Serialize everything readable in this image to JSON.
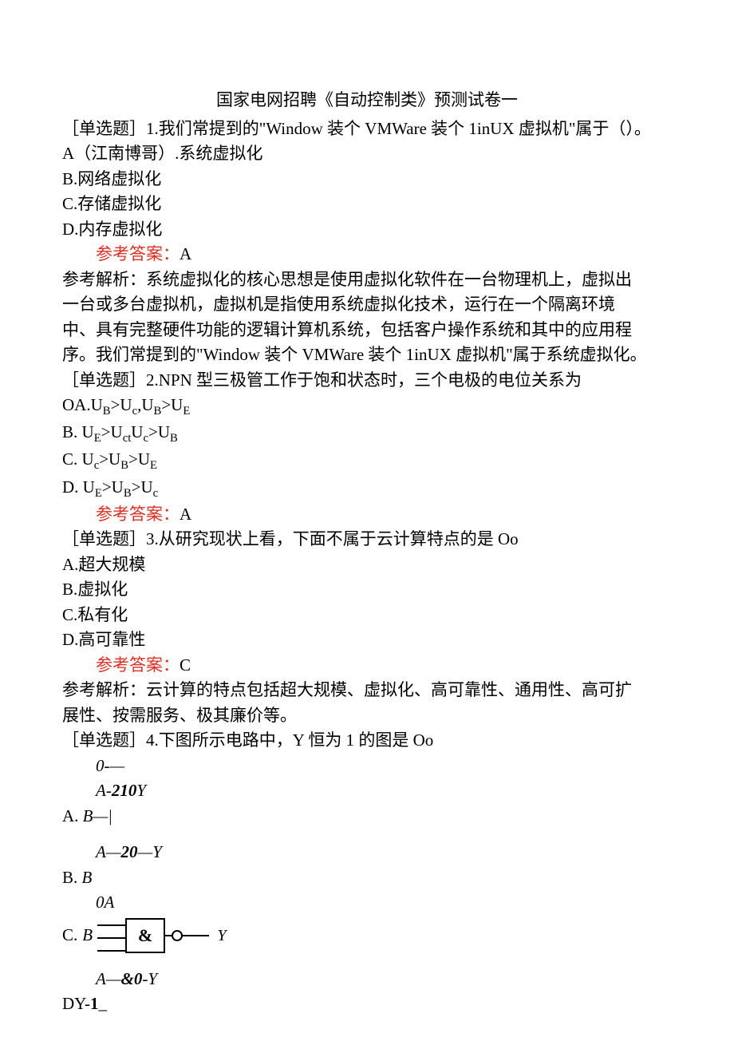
{
  "title": "国家电网招聘《自动控制类》预测试卷一",
  "q1": {
    "stem": "［单选题］1.我们常提到的\"Window 装个 VMWare 装个 1inUX 虚拟机\"属于（）。",
    "optA": "A（江南博哥）.系统虚拟化",
    "optB": "B.网络虚拟化",
    "optC": "C.存储虚拟化",
    "optD": "D.内存虚拟化",
    "ansLabel": "参考答案：",
    "ansVal": "A",
    "expl1": "参考解析：系统虚拟化的核心思想是使用虚拟化软件在一台物理机上，虚拟出",
    "expl2": "一台或多台虚拟机，虚拟机是指使用系统虚拟化技术，运行在一个隔离环境",
    "expl3": "中、具有完整硬件功能的逻辑计算机系统，包括客户操作系统和其中的应用程",
    "expl4": "序。我们常提到的\"Window 装个 VMWare 装个 1inUX 虚拟机\"属于系统虚拟化。"
  },
  "q2": {
    "stem": "［单选题］2.NPN 型三极管工作于饱和状态时，三个电极的电位关系为",
    "optA_pre": "OA.",
    "optA_main": "UB>Uc,UB>UE",
    "optB_pre": "B.  ",
    "optB_main": "UE>UctUc>UB",
    "optC_pre": "C.  ",
    "optC_main": "Uc>UB>UE",
    "optD_pre": "D.  ",
    "optD_main": "UE>UB>Uc",
    "ansLabel": "参考答案：",
    "ansVal": "A"
  },
  "q3": {
    "stem": "［单选题］3.从研究现状上看，下面不属于云计算特点的是 Oo",
    "optA": "A.超大规模",
    "optB": "B.虚拟化",
    "optC": "C.私有化",
    "optD": "D.高可靠性",
    "ansLabel": "参考答案：",
    "ansVal": "C",
    "expl1": "参考解析：云计算的特点包括超大规模、虚拟化、高可靠性、通用性、高可扩",
    "expl2": "展性、按需服务、极其廉价等。"
  },
  "q4": {
    "stem": "［单选题］4.下图所示电路中，Y 恒为 1 的图是 Oo",
    "lineA_top": "0-—",
    "lineA_mid": "A-210Y",
    "optA_pre": "A.  ",
    "optA_label": "B—|",
    "lineB_top": "A—20—Y",
    "optB_pre": "B.  ",
    "optB_label": "B",
    "lineC_top": "0A",
    "optC_pre": "C.  ",
    "optC_B": "B",
    "optC_amp": "&",
    "optC_Y": "Y",
    "lineD_top": "A—&0-Y",
    "optD": "DY-1_"
  }
}
